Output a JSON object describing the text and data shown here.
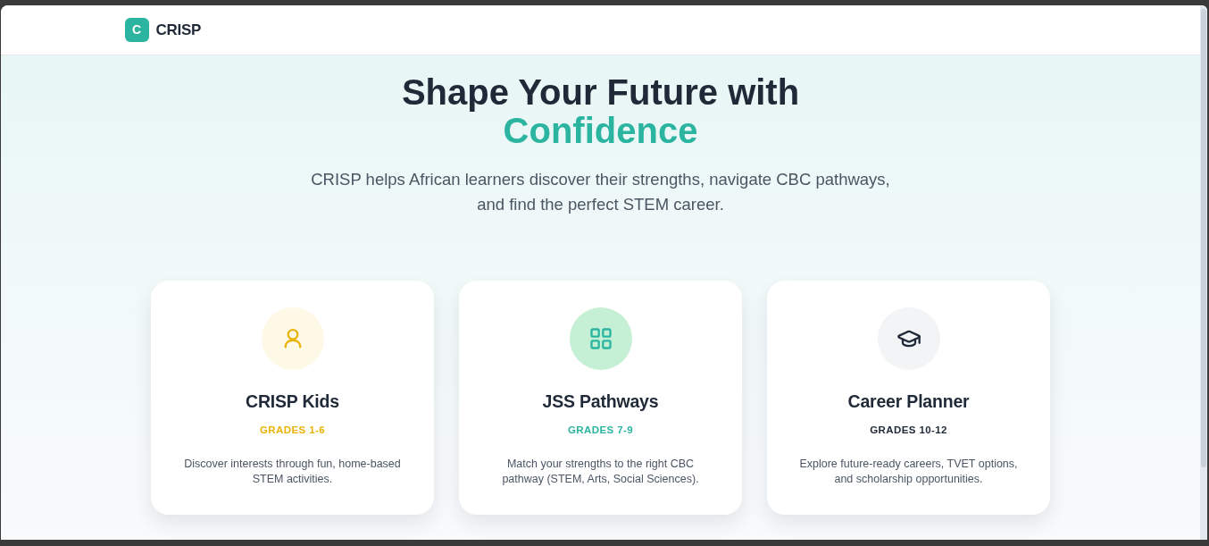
{
  "brand": {
    "logo_letter": "C",
    "name": "CRISP"
  },
  "hero": {
    "title": "Shape Your Future with",
    "highlight": "Confidence",
    "subtitle": "CRISP helps African learners discover their strengths, navigate CBC pathways, and find the perfect STEM career."
  },
  "cards": [
    {
      "kind": "person",
      "title": "CRISP Kids",
      "grades": "GRADES 1-6",
      "color": "#eab308",
      "description": "Discover interests through fun, home-based STEM activities."
    },
    {
      "kind": "grid",
      "title": "JSS Pathways",
      "grades": "GRADES 7-9",
      "color": "#2bb5a0",
      "description": "Match your strengths to the right CBC pathway (STEM, Arts, Social Sciences)."
    },
    {
      "kind": "cap",
      "title": "Career Planner",
      "grades": "GRADES 10-12",
      "color": "#1f2937",
      "description": "Explore future-ready careers, TVET options, and scholarship opportunities."
    }
  ]
}
